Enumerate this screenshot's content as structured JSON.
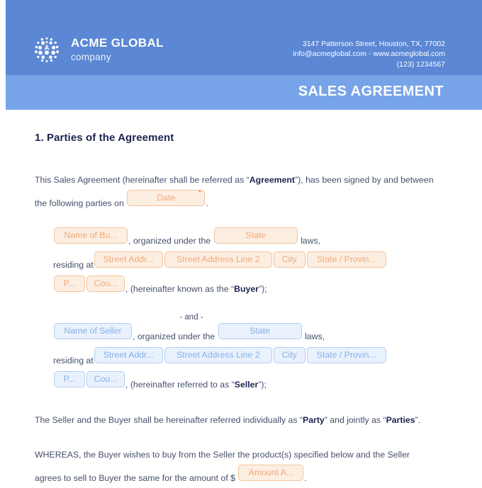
{
  "header": {
    "company_name": "ACME GLOBAL",
    "company_sub": "company",
    "logo_icon": "globe-dots-icon",
    "address": "3147 Patterson Street, Houston, TX, 77002",
    "email_web": "info@acmeglobal.com - www.acmeglobal.com",
    "phone": "(123) 1234567",
    "document_title": "SALES AGREEMENT",
    "band_color_top": "#5b87d4",
    "band_color_bottom": "#77a3e8"
  },
  "body": {
    "section_title": "1. Parties of the Agreement",
    "intro_part1": "This Sales Agreement (hereinafter shall be referred as “",
    "intro_bold": "Agreement",
    "intro_part2": "”), has been signed by and between",
    "intro_line2": "the following parties on",
    "intro_period": ".",
    "and_separator": "- and -",
    "organized_text": ", organized under the",
    "laws_text": "laws,",
    "residing_text": "residing at",
    "buyer_tail_pre": ", (hereinafter known as the “",
    "buyer_tail_bold": "Buyer",
    "buyer_tail_post": "”);",
    "seller_tail_pre": ", (hereinafter referred to as “",
    "seller_tail_bold": "Seller",
    "seller_tail_post": "”);",
    "party_para_1": "The Seller and the Buyer shall be hereinafter referred individually as “",
    "party_bold_1": "Party",
    "party_para_2": "” and jointly as “",
    "party_bold_2": "Parties",
    "party_para_3": "”.",
    "whereas_line1": "WHEREAS, the Buyer wishes to buy from the Seller the product(s) specified below and the Seller",
    "whereas_line2": "agrees to sell to Buyer the same for the amount of $",
    "whereas_period": "."
  },
  "fields": {
    "required_marker": "*",
    "date": {
      "placeholder": "Date",
      "value": "",
      "required": true,
      "style": "peach"
    },
    "buyer": {
      "name": {
        "placeholder": "Name of Bu...",
        "value": "",
        "style": "peach"
      },
      "state": {
        "placeholder": "State",
        "value": "",
        "style": "peach"
      },
      "street1": {
        "placeholder": "Street Addr...",
        "value": "",
        "style": "peach"
      },
      "street2": {
        "placeholder": "Street Address Line 2",
        "value": "",
        "style": "peach"
      },
      "city": {
        "placeholder": "City",
        "value": "",
        "style": "peach"
      },
      "state_province": {
        "placeholder": "State / Provin...",
        "value": "",
        "style": "peach"
      },
      "postal": {
        "placeholder": "P...",
        "value": "",
        "style": "peach"
      },
      "country": {
        "placeholder": "Cou...",
        "value": "",
        "style": "peach"
      }
    },
    "seller": {
      "name": {
        "placeholder": "Name of Seller",
        "value": "",
        "style": "blue"
      },
      "state": {
        "placeholder": "State",
        "value": "",
        "style": "blue"
      },
      "street1": {
        "placeholder": "Street Addr...",
        "value": "",
        "style": "blue"
      },
      "street2": {
        "placeholder": "Street Address Line 2",
        "value": "",
        "style": "blue"
      },
      "city": {
        "placeholder": "City",
        "value": "",
        "style": "blue"
      },
      "state_province": {
        "placeholder": "State / Provin...",
        "value": "",
        "style": "blue"
      },
      "postal": {
        "placeholder": "P...",
        "value": "",
        "style": "blue"
      },
      "country": {
        "placeholder": "Cou...",
        "value": "",
        "style": "blue"
      }
    },
    "amount": {
      "placeholder": "Amount A...",
      "value": "",
      "style": "peach"
    }
  },
  "colors": {
    "peach_fill": "#fdeee2",
    "peach_border": "#f3c49a",
    "peach_text": "#f0a97a",
    "blue_fill": "#e9f1fd",
    "blue_border": "#b4cef1",
    "blue_text": "#85b0ea",
    "heading": "#1e2450",
    "body_text": "#46506b",
    "required_star": "#f0604a"
  }
}
